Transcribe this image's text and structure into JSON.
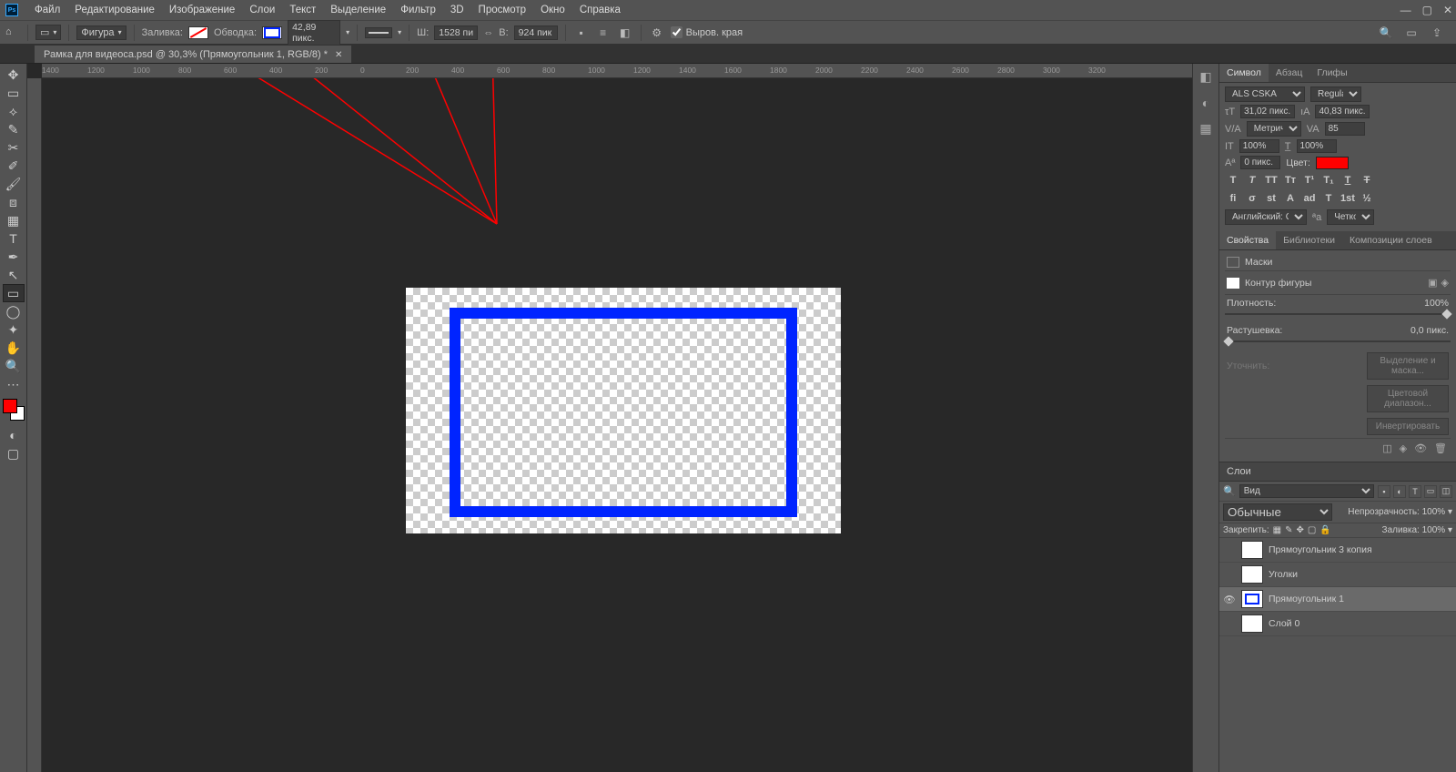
{
  "menu": {
    "items": [
      "Файл",
      "Редактирование",
      "Изображение",
      "Слои",
      "Текст",
      "Выделение",
      "Фильтр",
      "3D",
      "Просмотр",
      "Окно",
      "Справка"
    ]
  },
  "options": {
    "shape_mode": "Фигура",
    "fill_label": "Заливка:",
    "stroke_label": "Обводка:",
    "stroke_width": "42,89 пикс.",
    "w_label": "Ш:",
    "w_value": "1528 пи",
    "link_icon": "⇔",
    "h_label": "В:",
    "h_value": "924 пик",
    "align_edges_label": "Выров. края"
  },
  "tab": {
    "title": "Рамка для видеоса.psd @ 30,3% (Прямоугольник 1, RGB/8) *"
  },
  "ruler_ticks": [
    "1400",
    "1200",
    "1000",
    "800",
    "600",
    "400",
    "200",
    "0",
    "200",
    "400",
    "600",
    "800",
    "1000",
    "1200",
    "1400",
    "1600",
    "1800",
    "2000",
    "2200",
    "2400",
    "2600",
    "2800",
    "3000",
    "3200"
  ],
  "char_panel": {
    "tabs": [
      "Символ",
      "Абзац",
      "Глифы"
    ],
    "font": "ALS CSKA",
    "style": "Regular",
    "size": "31,02 пикс.",
    "leading": "40,83 пикс.",
    "kerning": "Метрически",
    "tracking": "85",
    "vscale": "100%",
    "hscale": "100%",
    "baseline": "0 пикс.",
    "color_label": "Цвет:",
    "language": "Английский: США",
    "aa": "Четкое"
  },
  "props_panel": {
    "tabs": [
      "Свойства",
      "Библиотеки",
      "Композиции слоев"
    ],
    "masks_label": "Маски",
    "path_label": "Контур фигуры",
    "density_label": "Плотность:",
    "density_value": "100%",
    "feather_label": "Растушевка:",
    "feather_value": "0,0 пикс.",
    "refine_label": "Уточнить:",
    "btn1": "Выделение и маска...",
    "btn2": "Цветовой диапазон...",
    "btn3": "Инвертировать"
  },
  "layers_panel": {
    "title": "Слои",
    "kind": "Вид",
    "blend": "Обычные",
    "opacity_label": "Непрозрачность:",
    "opacity_value": "100%",
    "lock_label": "Закрепить:",
    "fill_label": "Заливка:",
    "fill_value": "100%",
    "layers": [
      {
        "name": "Прямоугольник 3 копия",
        "visible": false
      },
      {
        "name": "Уголки",
        "visible": false
      },
      {
        "name": "Прямоугольник 1",
        "visible": true,
        "selected": true
      },
      {
        "name": "Слой 0",
        "visible": false
      }
    ]
  }
}
